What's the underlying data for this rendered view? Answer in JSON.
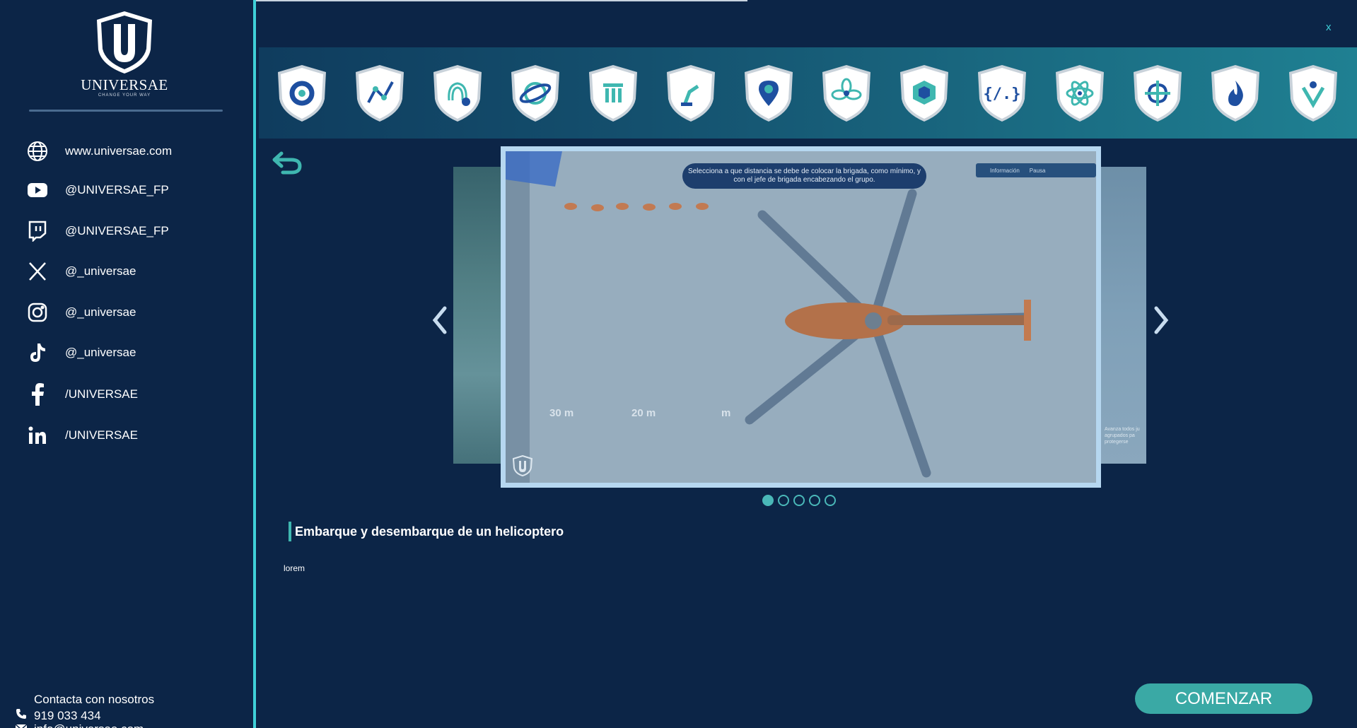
{
  "brand": {
    "name": "UNIVERSAE",
    "tagline": "CHANGE YOUR WAY"
  },
  "social": [
    {
      "icon": "globe-icon",
      "label": "www.universae.com"
    },
    {
      "icon": "youtube-icon",
      "label": "@UNIVERSAE_FP"
    },
    {
      "icon": "twitch-icon",
      "label": "@UNIVERSAE_FP"
    },
    {
      "icon": "x-icon",
      "label": "@_universae"
    },
    {
      "icon": "instagram-icon",
      "label": "@_universae"
    },
    {
      "icon": "tiktok-icon",
      "label": "@_universae"
    },
    {
      "icon": "facebook-icon",
      "label": "/UNIVERSAE"
    },
    {
      "icon": "linkedin-icon",
      "label": "/UNIVERSAE"
    }
  ],
  "contact": {
    "title": "Contacta con nosotros",
    "phone": "919 033 434",
    "email": "info@universae.com"
  },
  "close_label": "x",
  "badges": [
    "gear-badge-icon",
    "graph-badge-icon",
    "fingerprint-badge-icon",
    "globe-orbit-badge-icon",
    "columns-badge-icon",
    "robot-arm-badge-icon",
    "location-pin-badge-icon",
    "flower-badge-icon",
    "cube-badge-icon",
    "code-badge-icon",
    "atom-badge-icon",
    "cross-loop-badge-icon",
    "flame-badge-icon",
    "people-badge-icon"
  ],
  "slide": {
    "instruction": "Selecciona a que distancia se debe de colocar la brigada, como mínimo, y con el jefe de brigada encabezando el grupo.",
    "hud_info": "Información",
    "hud_pause": "Pausa",
    "dist_labels": [
      "30 m",
      "20 m",
      "m"
    ],
    "side_caption": "Avanza todos ju agrupados pa protegerse"
  },
  "carousel": {
    "count": 5,
    "active": 0
  },
  "activity": {
    "title": "Embarque y desembarque de un helicoptero",
    "description": "lorem"
  },
  "start_label": "COMENZAR",
  "colors": {
    "background": "#0c2547",
    "accent": "#3fd0d8",
    "button": "#3aa9a5"
  }
}
